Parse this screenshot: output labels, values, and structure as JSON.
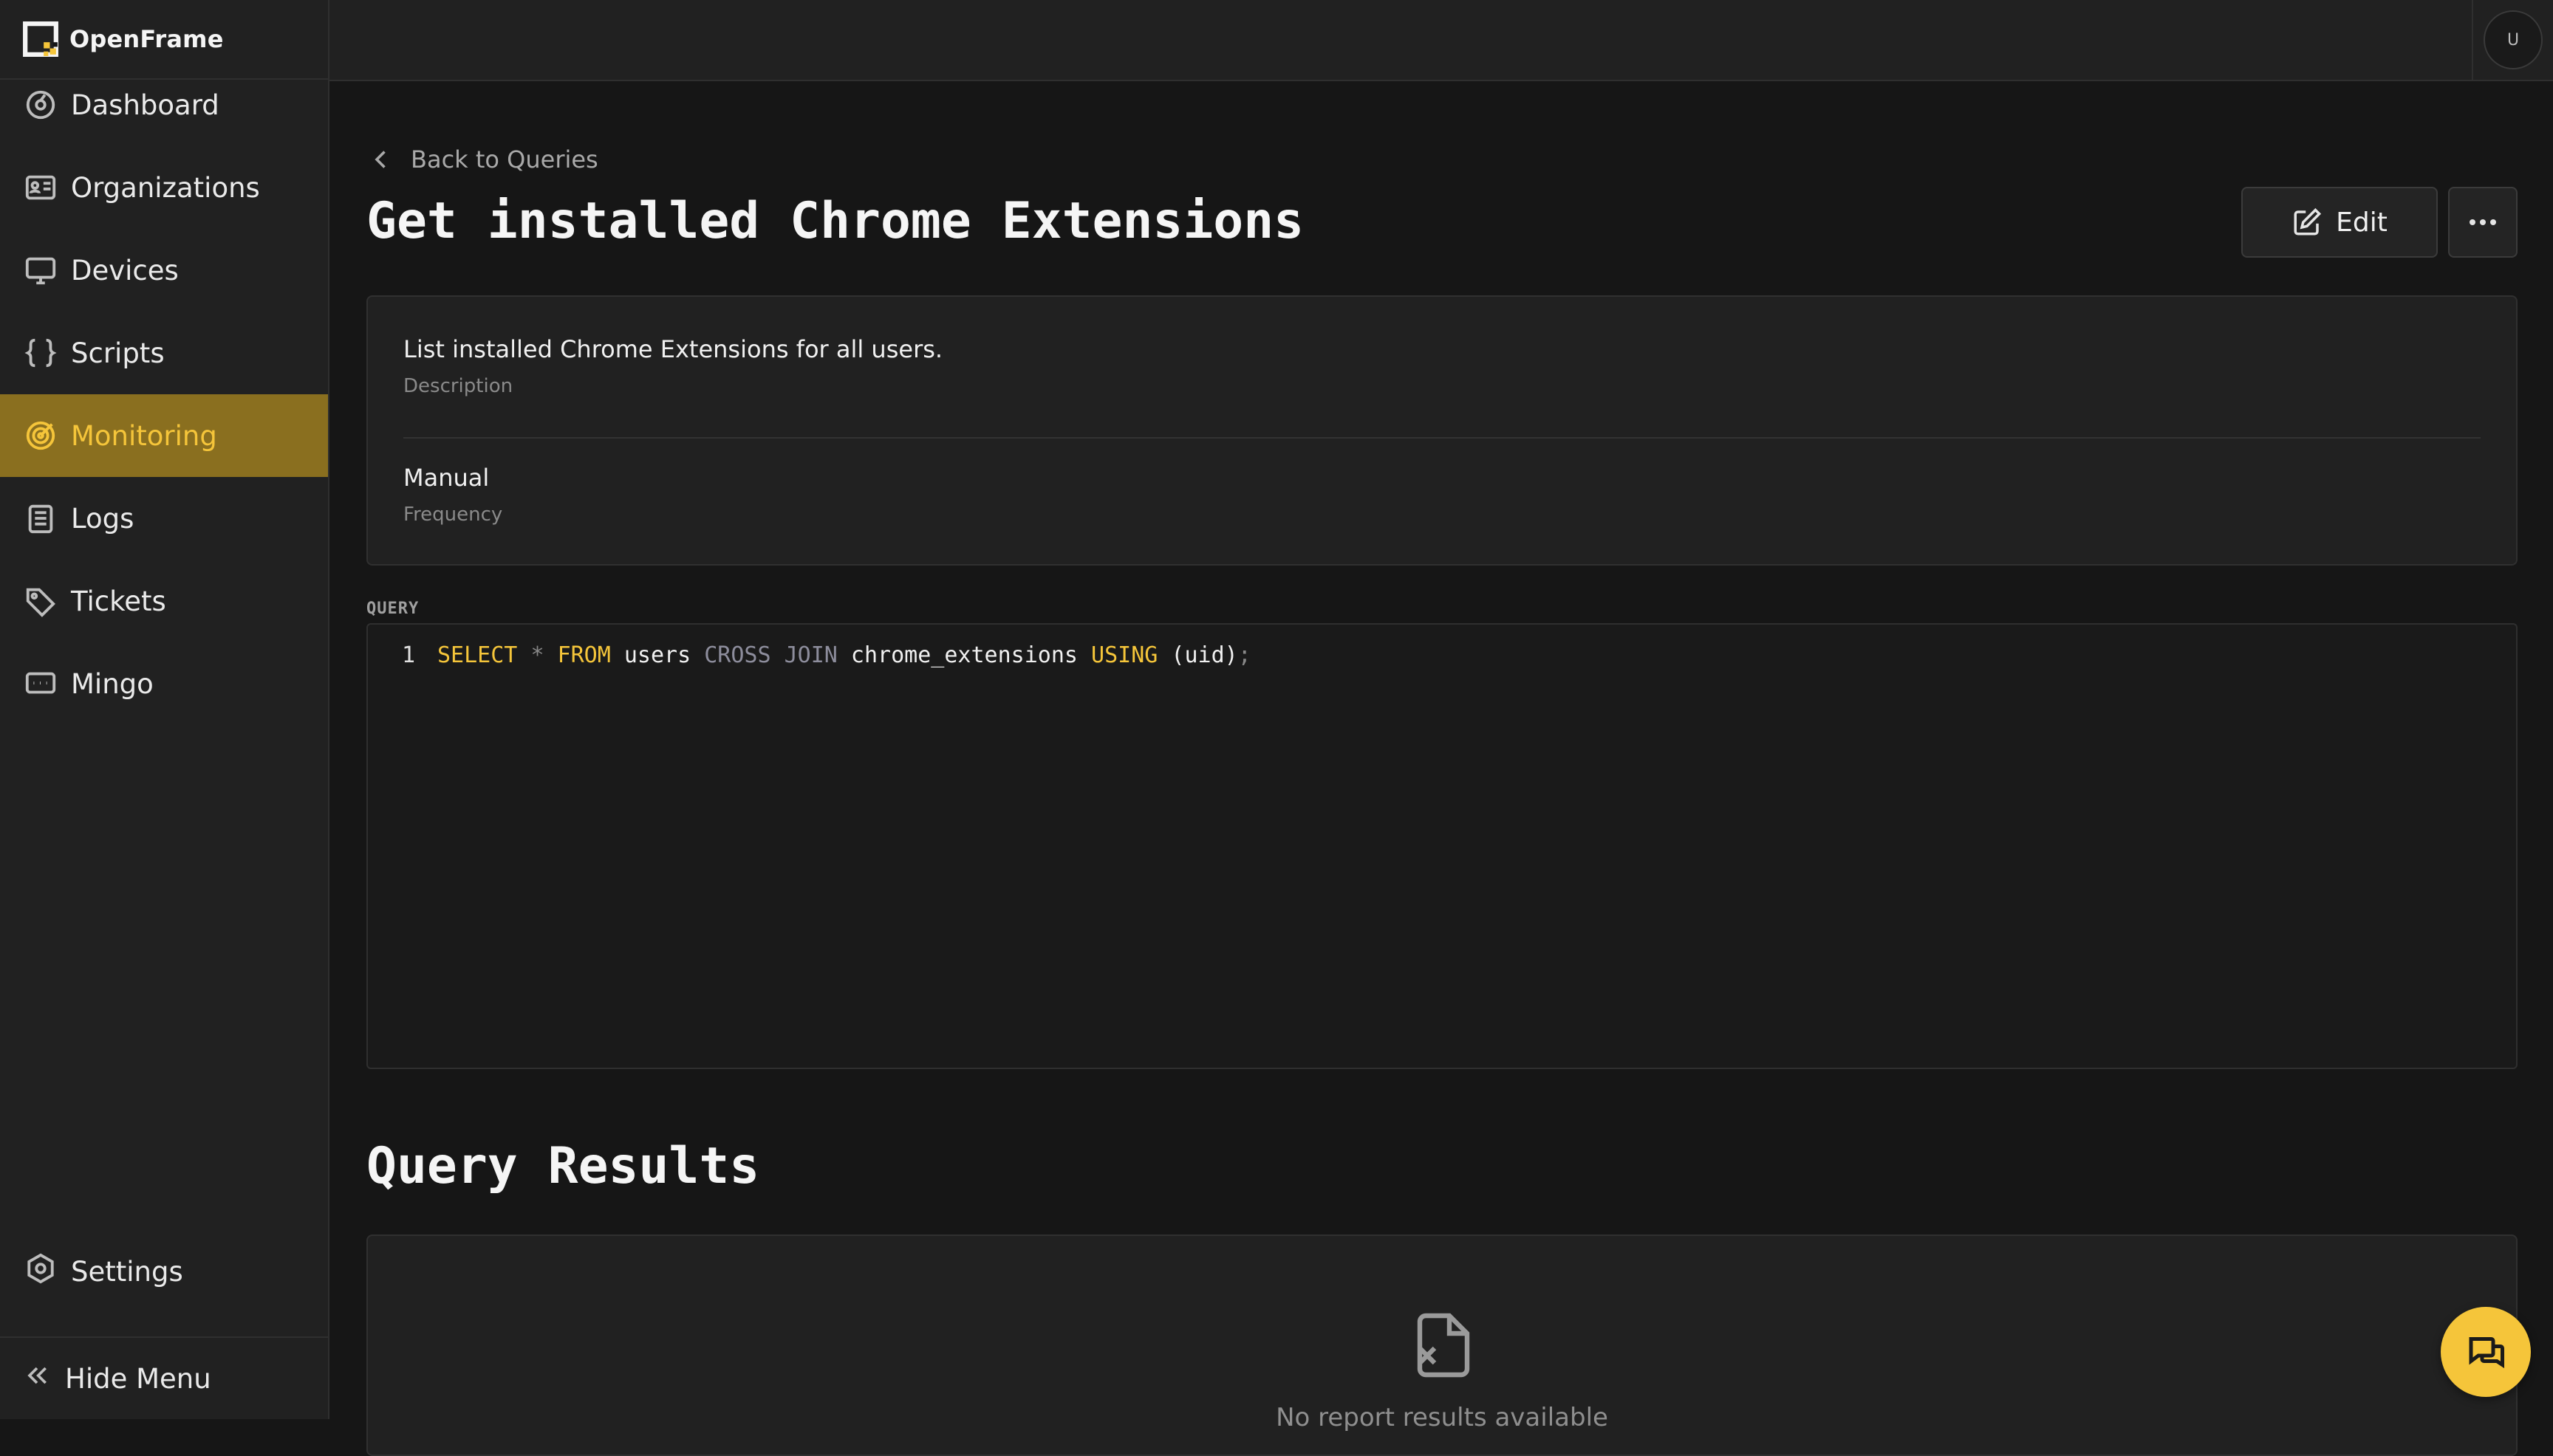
{
  "app": {
    "name": "OpenFrame"
  },
  "sidebar": {
    "items": [
      {
        "label": "Dashboard",
        "icon": "dashboard-icon"
      },
      {
        "label": "Organizations",
        "icon": "organizations-icon"
      },
      {
        "label": "Devices",
        "icon": "monitor-icon"
      },
      {
        "label": "Scripts",
        "icon": "braces-icon"
      },
      {
        "label": "Monitoring",
        "icon": "target-icon",
        "active": true
      },
      {
        "label": "Logs",
        "icon": "clipboard-icon"
      },
      {
        "label": "Tickets",
        "icon": "tag-icon"
      },
      {
        "label": "Mingo",
        "icon": "chat-terminal-icon"
      }
    ],
    "settings": {
      "label": "Settings",
      "icon": "gear-icon"
    },
    "hide_menu": {
      "label": "Hide Menu",
      "icon": "chevrons-left-icon"
    }
  },
  "topbar": {
    "avatar_initial": "U"
  },
  "page": {
    "back_label": "Back to Queries",
    "title": "Get installed Chrome Extensions",
    "edit_label": "Edit"
  },
  "info": {
    "description_value": "List installed Chrome Extensions for all users.",
    "description_label": "Description",
    "frequency_value": "Manual",
    "frequency_label": "Frequency"
  },
  "query": {
    "label": "QUERY",
    "line_number": "1",
    "tokens": [
      {
        "text": "SELECT",
        "kind": "kw"
      },
      {
        "text": " ",
        "kind": "id"
      },
      {
        "text": "*",
        "kind": "op"
      },
      {
        "text": " ",
        "kind": "id"
      },
      {
        "text": "FROM",
        "kind": "kw"
      },
      {
        "text": " users ",
        "kind": "id"
      },
      {
        "text": "CROSS JOIN",
        "kind": "kw2"
      },
      {
        "text": " chrome_extensions ",
        "kind": "id"
      },
      {
        "text": "USING",
        "kind": "kw"
      },
      {
        "text": " (uid)",
        "kind": "id"
      },
      {
        "text": ";",
        "kind": "op"
      }
    ]
  },
  "results": {
    "title": "Query Results",
    "empty_text": "No report results available"
  },
  "colors": {
    "accent": "#f5c53a",
    "active_bg": "#8a6f1f",
    "background": "#161616",
    "panel": "#212121"
  }
}
